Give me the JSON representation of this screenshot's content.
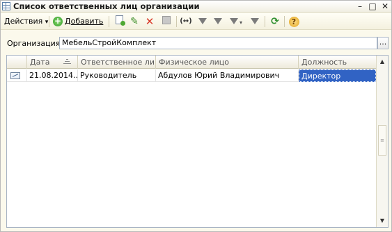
{
  "window": {
    "title": "Список ответственных лиц организации",
    "minimize": "–",
    "maximize": "□",
    "close": "✕"
  },
  "toolbar": {
    "actions_label": "Действия",
    "actions_arrow": "▾",
    "add_label": "Добавить",
    "add_glyph": "+",
    "help_glyph": "?",
    "swap_glyph": "(↔)",
    "refresh_glyph": "⟳"
  },
  "organization": {
    "label": "Организация:",
    "value": "МебельСтройКомплект",
    "select_button": "..."
  },
  "table": {
    "columns": [
      "Дата",
      "Ответственное лицо",
      "Физическое лицо",
      "Должность"
    ],
    "rows": [
      {
        "date": "21.08.2014...",
        "role": "Руководитель",
        "person": "Абдулов Юрий Владимирович",
        "position": "Директор"
      }
    ]
  },
  "scrollbar": {
    "up": "▲",
    "down": "▼",
    "thumb": "≡"
  },
  "icons": {
    "window": "table-icon",
    "copy": "copy-icon",
    "edit": "pencil-icon",
    "delete": "red-cross-icon",
    "save": "disk-icon",
    "filter": "filter-icon",
    "filter_by_value": "filter-value-icon",
    "filter_menu": "filter-dropdown-icon",
    "filter_clear": "filter-clear-icon",
    "refresh": "refresh-icon",
    "help": "help-icon"
  },
  "colors": {
    "selection": "#3163c4",
    "delete": "#d93b2b",
    "edit": "#3e8f2a",
    "window_bg": "#fbf9ec"
  }
}
